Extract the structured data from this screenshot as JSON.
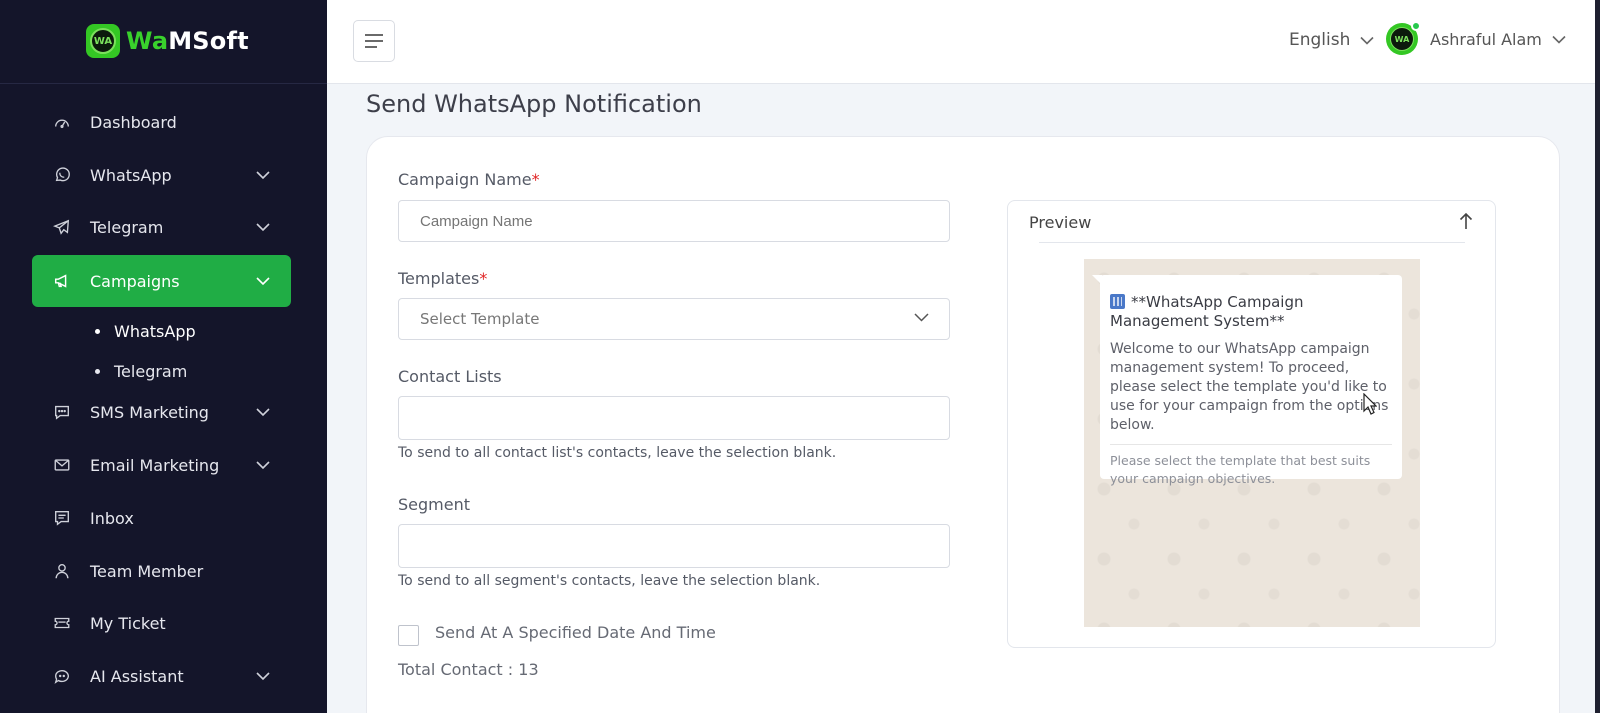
{
  "brand": {
    "wa": "Wa",
    "rest": "MSoft",
    "badge": "WA"
  },
  "sidebar": {
    "items": [
      {
        "label": "Dashboard",
        "icon": "dashboard-icon"
      },
      {
        "label": "WhatsApp",
        "icon": "whatsapp-icon"
      },
      {
        "label": "Telegram",
        "icon": "telegram-icon"
      },
      {
        "label": "Campaigns",
        "icon": "megaphone-icon"
      },
      {
        "label": "SMS Marketing",
        "icon": "sms-icon"
      },
      {
        "label": "Email Marketing",
        "icon": "email-icon"
      },
      {
        "label": "Inbox",
        "icon": "inbox-icon"
      },
      {
        "label": "Team Member",
        "icon": "user-icon"
      },
      {
        "label": "My Ticket",
        "icon": "ticket-icon"
      },
      {
        "label": "AI Assistant",
        "icon": "ai-icon"
      }
    ],
    "campaign_sub": [
      {
        "label": "WhatsApp"
      },
      {
        "label": "Telegram"
      }
    ],
    "active_color": "#20ad45"
  },
  "topbar": {
    "language": "English",
    "user_name": "Ashraful Alam"
  },
  "page": {
    "title": "Send WhatsApp Notification"
  },
  "form": {
    "campaign_name": {
      "label": "Campaign Name",
      "required": "*",
      "placeholder": "Campaign Name"
    },
    "templates": {
      "label": "Templates",
      "required": "*",
      "value": "Select Template"
    },
    "contact_lists": {
      "label": "Contact Lists",
      "help": "To send to all contact list's contacts, leave the selection blank."
    },
    "segment": {
      "label": "Segment",
      "help": "To send to all segment's contacts, leave the selection blank."
    },
    "schedule": {
      "label": "Send At A Specified Date And Time"
    },
    "total": "Total Contact : 13"
  },
  "preview": {
    "title": "Preview",
    "message_title": "**WhatsApp Campaign Management System**",
    "message_body": "Welcome to our WhatsApp campaign management system! To proceed, please select the template you'd like to use for your campaign from the options below.",
    "message_footer": "Please select the template that best suits your campaign objectives."
  }
}
